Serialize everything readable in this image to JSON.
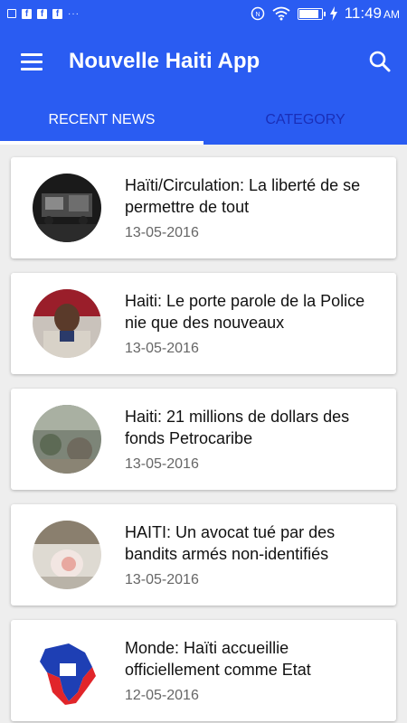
{
  "status_bar": {
    "time": "11:49",
    "ampm": "AM",
    "fb_glyph": "f",
    "more_glyph": "···",
    "icons": [
      "image-icon",
      "facebook-icon",
      "facebook-icon",
      "facebook-icon",
      "more-icon",
      "nfc-icon",
      "wifi-icon",
      "battery-icon",
      "charging-icon"
    ]
  },
  "app_bar": {
    "title": "Nouvelle Haiti App",
    "menu_icon": "menu-icon",
    "search_icon": "search-icon"
  },
  "tabs": [
    {
      "label": "RECENT NEWS",
      "active": true
    },
    {
      "label": "CATEGORY",
      "active": false
    }
  ],
  "articles": [
    {
      "title": "Haïti/Circulation: La liberté de se permettre de tout",
      "date": "13-05-2016"
    },
    {
      "title": "Haiti: Le porte parole de la Police nie que des nouveaux",
      "date": "13-05-2016"
    },
    {
      "title": "Haiti: 21 millions de dollars des fonds Petrocaribe",
      "date": "13-05-2016"
    },
    {
      "title": "HAITI: Un avocat tué par des bandits armés non-identifiés",
      "date": "13-05-2016"
    },
    {
      "title": "Monde: Haïti accueillie officiellement comme Etat",
      "date": "12-05-2016"
    }
  ],
  "colors": {
    "primary": "#2a5cf2",
    "inactive_tab": "#1a2fb8",
    "background": "#eeeeee"
  }
}
